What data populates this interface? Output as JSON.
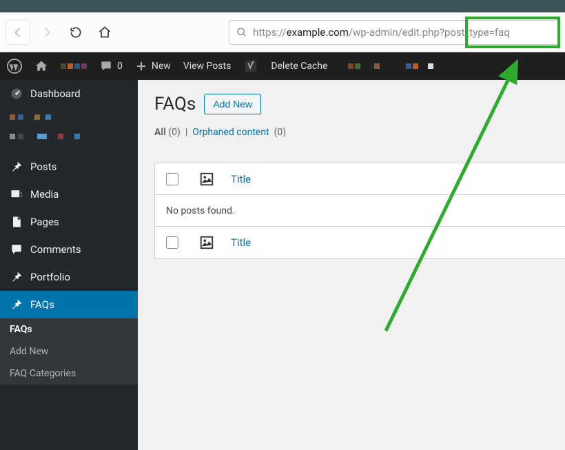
{
  "url": {
    "prefix": "https://",
    "domain": "example.com",
    "path": "/wp-admin/edit.php",
    "query": "?post_type=faq"
  },
  "adminbar": {
    "comments_count": "0",
    "new_label": "New",
    "view_label": "View Posts",
    "cache_label": "Delete Cache"
  },
  "sidebar": {
    "dashboard": "Dashboard",
    "posts": "Posts",
    "media": "Media",
    "pages": "Pages",
    "comments": "Comments",
    "portfolio": "Portfolio",
    "faqs": "FAQs",
    "sub": {
      "faqs": "FAQs",
      "add_new": "Add New",
      "categories": "FAQ Categories"
    }
  },
  "content": {
    "title": "FAQs",
    "add_new": "Add New",
    "filter_all": "All",
    "filter_all_count": "(0)",
    "filter_sep": "|",
    "filter_orphaned": "Orphaned content",
    "filter_orphaned_count": "(0)",
    "col_title": "Title",
    "no_posts": "No posts found."
  }
}
